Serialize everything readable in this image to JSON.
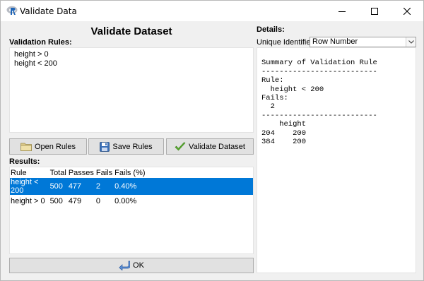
{
  "window": {
    "title": "Validate Data",
    "minimize_glyph": "—",
    "maximize_glyph": "☐",
    "close_glyph": "✕"
  },
  "left": {
    "heading": "Validate Dataset",
    "rules_label": "Validation Rules:",
    "rules": [
      "height > 0",
      "height < 200"
    ],
    "buttons": {
      "open": "Open Rules",
      "save": "Save Rules",
      "validate": "Validate Dataset"
    },
    "results_label": "Results:",
    "results": {
      "columns": [
        "Rule",
        "Total",
        "Passes",
        "Fails",
        "Fails (%)"
      ],
      "rows": [
        {
          "rule": "height < 200",
          "total": "500",
          "passes": "477",
          "fails": "2",
          "fails_pct": "0.40%",
          "selected": true
        },
        {
          "rule": "height > 0",
          "total": "500",
          "passes": "479",
          "fails": "0",
          "fails_pct": "0.00%",
          "selected": false
        }
      ]
    },
    "ok_label": "OK"
  },
  "right": {
    "details_label": "Details:",
    "unique_id_label": "Unique Identifier:",
    "unique_id_value": "Row Number",
    "details_lines": [
      "Summary of Validation Rule",
      "--------------------------",
      "Rule:",
      "  height < 200",
      "Fails:",
      "  2",
      "--------------------------",
      "    height",
      "204    200",
      "384    200"
    ]
  },
  "colors": {
    "selection": "#0078d7",
    "panel_bg": "#f0f0f0",
    "button_bg": "#e1e1e1"
  },
  "icons": {
    "app": "r-logo-icon",
    "open": "folder-icon",
    "save": "floppy-disk-icon",
    "validate": "checkmark-icon",
    "ok": "return-arrow-icon",
    "dropdown": "chevron-down-icon"
  }
}
